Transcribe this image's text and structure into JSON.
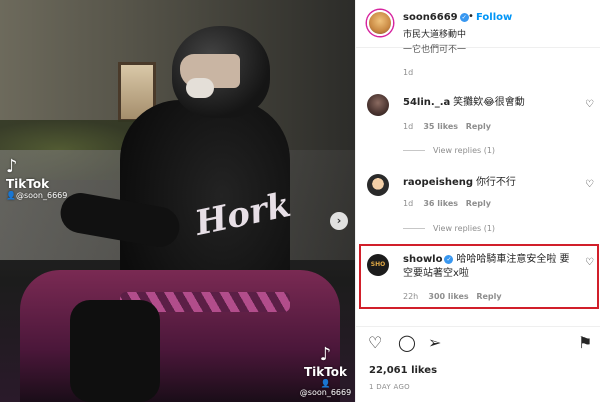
{
  "video": {
    "watermark_top": {
      "logo": "♪",
      "word": "TikTok",
      "user": "👤@soon_6669"
    },
    "watermark_bottom": {
      "logo": "♪",
      "word": "TikTok",
      "user": "👤@soon_6669"
    },
    "next_icon": "›"
  },
  "header": {
    "username": "soon6669",
    "verified_glyph": "✓",
    "dot": "•",
    "follow_label": "Follow",
    "location": "市民大道移動中"
  },
  "comments": [
    {
      "username": "54lin._.a",
      "text": "笑攤欸😂很會動",
      "time": "1d",
      "likes": "35 likes",
      "reply": "Reply",
      "view_replies": "View replies (1)"
    },
    {
      "username": "raopeisheng",
      "text": "你行不行",
      "time": "1d",
      "likes": "36 likes",
      "reply": "Reply",
      "view_replies": "View replies (1)"
    },
    {
      "username": "showlo",
      "verified_glyph": "✓",
      "text_line1": "哈哈哈騎車注意安全啦 要",
      "text_line2": "空要站著空x啦",
      "time": "22h",
      "likes": "300 likes",
      "reply": "Reply",
      "avatar_text": "SHO"
    }
  ],
  "previous_comment": {
    "cut_text": "一它也們可不一",
    "time": "1d"
  },
  "heart_icon": "♡",
  "actions": {
    "like_icon": "♡",
    "comment_icon": "◯",
    "share_icon": "➢",
    "save_icon": "⚑",
    "likes_total": "22,061 likes",
    "post_time": "1 DAY AGO"
  },
  "colors": {
    "accent": "#0095f6",
    "highlight_border": "#d11f2a",
    "verified": "#3897f0"
  }
}
